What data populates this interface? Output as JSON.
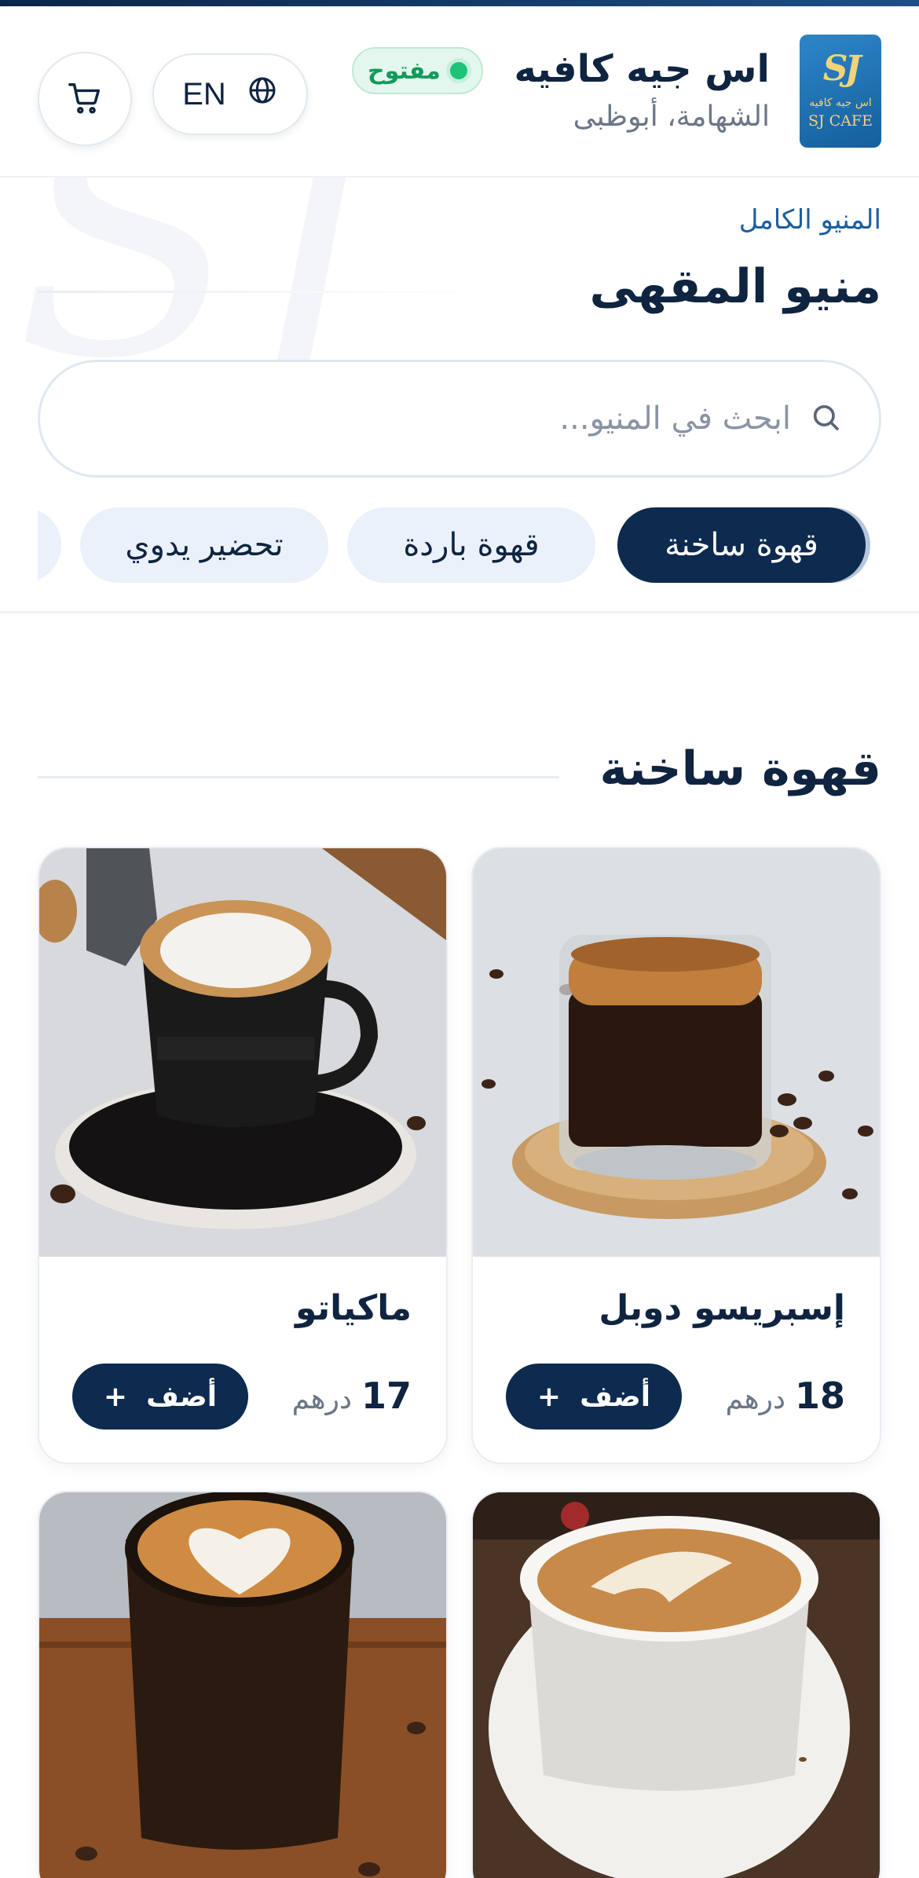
{
  "colors": {
    "brand_navy": "#0d2a4f",
    "open_green": "#1cc477",
    "link_blue": "#1c5fa0"
  },
  "header": {
    "logo": {
      "monogram": "SJ",
      "arabic": "اس جيه كافيه",
      "english": "SJ CAFE"
    },
    "cafe_name": "اس جيه كافيه",
    "location": "الشهامة، أبوظبى",
    "status": "مفتوح",
    "language_label": "EN",
    "icons": {
      "language": "globe-icon",
      "cart": "cart-icon"
    }
  },
  "breadcrumb": "المنيو الكامل",
  "page_title": "منيو المقهى",
  "search": {
    "placeholder": "ابحث في المنيو...",
    "value": ""
  },
  "categories": [
    {
      "label": "قهوة ساخنة",
      "active": true
    },
    {
      "label": "قهوة باردة",
      "active": false
    },
    {
      "label": "تحضير يدوي",
      "active": false
    }
  ],
  "section": {
    "title": "قهوة ساخنة"
  },
  "products": [
    {
      "name": "إسبريسو دوبل",
      "price": "18",
      "currency": "درهم",
      "add_label": "أضف"
    },
    {
      "name": "ماكياتو",
      "price": "17",
      "currency": "درهم",
      "add_label": "أضف"
    },
    {
      "name": "",
      "price": "",
      "currency": "",
      "add_label": ""
    },
    {
      "name": "",
      "price": "",
      "currency": "",
      "add_label": ""
    }
  ]
}
